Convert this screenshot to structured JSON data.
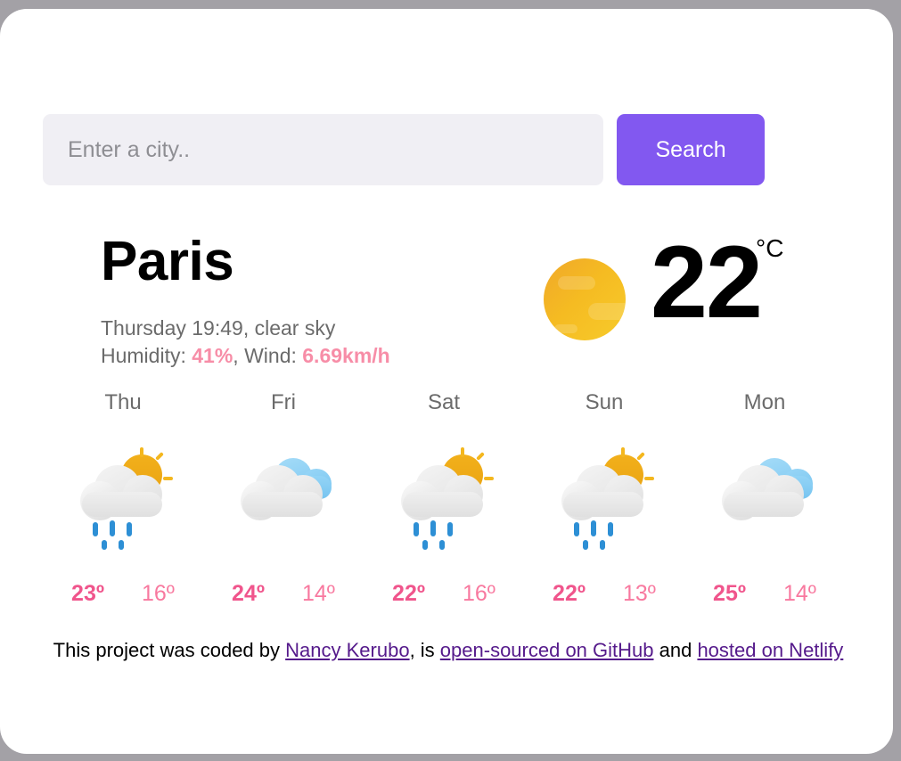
{
  "search": {
    "placeholder": "Enter a city..",
    "value": "",
    "button_label": "Search"
  },
  "current": {
    "city": "Paris",
    "day_time": "Thursday 19:49",
    "description": "clear sky",
    "conditions_line": "Thursday 19:49, clear sky",
    "humidity_label": "Humidity:",
    "humidity_value": "41%",
    "wind_label": "Wind:",
    "wind_value": "6.69km/h",
    "separator": ", ",
    "temperature": "22",
    "unit": "°C",
    "icon": "sun-icon"
  },
  "forecast": [
    {
      "day": "Thu",
      "icon": "sun-behind-rain-cloud-icon",
      "max": "23º",
      "min": "16º"
    },
    {
      "day": "Fri",
      "icon": "broken-clouds-icon",
      "max": "24º",
      "min": "14º"
    },
    {
      "day": "Sat",
      "icon": "sun-behind-rain-cloud-icon",
      "max": "22º",
      "min": "16º"
    },
    {
      "day": "Sun",
      "icon": "sun-behind-rain-cloud-icon",
      "max": "22º",
      "min": "13º"
    },
    {
      "day": "Mon",
      "icon": "broken-clouds-icon",
      "max": "25º",
      "min": "14º"
    }
  ],
  "footer": {
    "text_1": "This project was coded by ",
    "link_author": "Nancy Kerubo",
    "text_2": ", is ",
    "link_github": "open-sourced on GitHub",
    "text_3": " and ",
    "link_netlify": "hosted on Netlify"
  },
  "colors": {
    "page_background": "#a3a1a6",
    "card_background": "#ffffff",
    "accent_purple": "#8258f0",
    "metric_pink": "#f78da7",
    "temp_max_pink": "#f0558c",
    "temp_min_pink": "#f8799f",
    "link_purple": "#551a8b",
    "sun_yellow": "#f5bb22",
    "raindrop_blue": "#2d8fd5",
    "cloud_blue": "#8ecff4"
  }
}
